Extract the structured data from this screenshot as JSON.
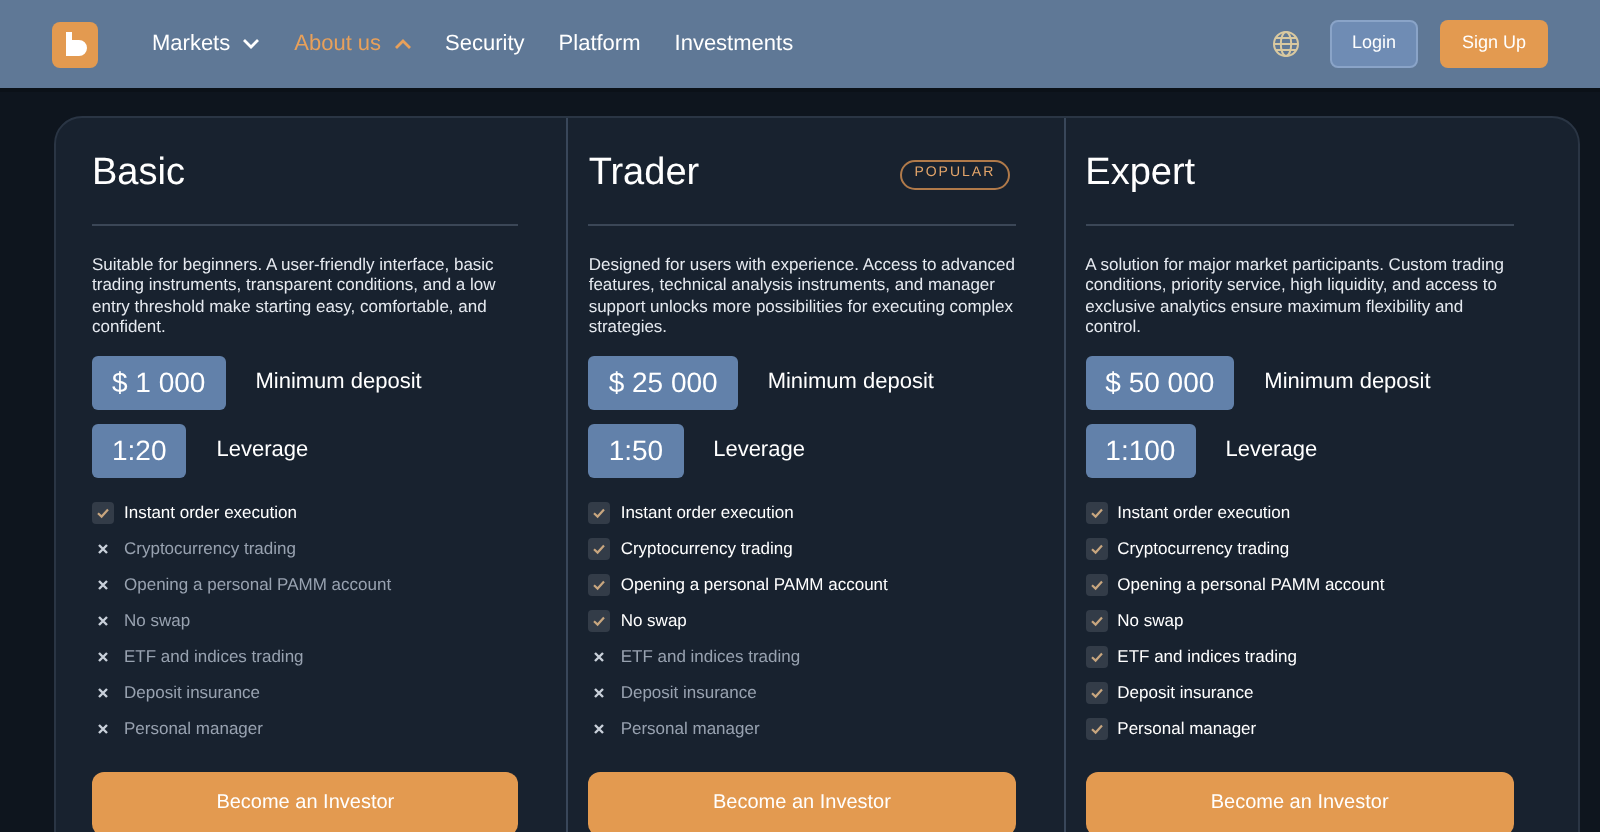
{
  "header": {
    "nav": [
      {
        "label": "Markets",
        "kind": "dropdown",
        "selected": false,
        "expanded": false
      },
      {
        "label": "About us",
        "kind": "dropdown",
        "selected": true,
        "expanded": true
      },
      {
        "label": "Security",
        "kind": "link",
        "selected": false
      },
      {
        "label": "Platform",
        "kind": "link",
        "selected": false
      },
      {
        "label": "Investments",
        "kind": "link",
        "selected": false
      }
    ],
    "login": "Login",
    "signup": "Sign Up"
  },
  "plans": [
    {
      "title": "Basic",
      "description": "Suitable for beginners. A user-friendly interface, basic trading instruments, transparent conditions, and a low entry threshold make starting easy, comfortable, and confident.",
      "deposit": "$ 1 000",
      "deposit_label": "Minimum deposit",
      "leverage": "1:20",
      "leverage_label": "Leverage",
      "features": [
        {
          "label": "Instant order execution",
          "included": true
        },
        {
          "label": "Cryptocurrency trading",
          "included": false
        },
        {
          "label": "Opening a personal PAMM account",
          "included": false
        },
        {
          "label": "No swap",
          "included": false
        },
        {
          "label": "ETF and indices trading",
          "included": false
        },
        {
          "label": "Deposit insurance",
          "included": false
        },
        {
          "label": "Personal manager",
          "included": false
        }
      ],
      "button": "Become an Investor"
    },
    {
      "title": "Trader",
      "badge": "POPULAR",
      "description": "Designed for users with experience. Access to advanced features, technical analysis instruments, and manager support unlocks more possibilities for executing complex strategies.",
      "deposit": "$ 25 000",
      "deposit_label": "Minimum deposit",
      "leverage": "1:50",
      "leverage_label": "Leverage",
      "features": [
        {
          "label": "Instant order execution",
          "included": true
        },
        {
          "label": "Cryptocurrency trading",
          "included": true
        },
        {
          "label": "Opening a personal PAMM account",
          "included": true
        },
        {
          "label": "No swap",
          "included": true
        },
        {
          "label": "ETF and indices trading",
          "included": false
        },
        {
          "label": "Deposit insurance",
          "included": false
        },
        {
          "label": "Personal manager",
          "included": false
        }
      ],
      "button": "Become an Investor"
    },
    {
      "title": "Expert",
      "description": "A solution for major market participants. Custom trading conditions, priority service, high liquidity, and access to exclusive analytics ensure maximum flexibility and control.",
      "deposit": "$ 50 000",
      "deposit_label": "Minimum deposit",
      "leverage": "1:100",
      "leverage_label": "Leverage",
      "features": [
        {
          "label": "Instant order execution",
          "included": true
        },
        {
          "label": "Cryptocurrency trading",
          "included": true
        },
        {
          "label": "Opening a personal PAMM account",
          "included": true
        },
        {
          "label": "No swap",
          "included": true
        },
        {
          "label": "ETF and indices trading",
          "included": true
        },
        {
          "label": "Deposit insurance",
          "included": true
        },
        {
          "label": "Personal manager",
          "included": true
        }
      ],
      "button": "Become an Investor"
    }
  ]
}
